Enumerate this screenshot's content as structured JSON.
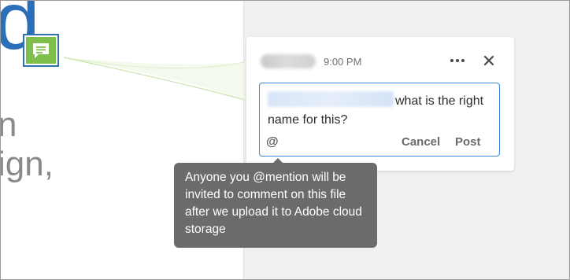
{
  "document": {
    "heading_fragment": "d",
    "line1_fragment": "n",
    "line2_fragment": "ign,"
  },
  "comment": {
    "time": "9:00 PM",
    "draft_text": "what is the right name for this?",
    "actions": {
      "mention_label": "@",
      "cancel_label": "Cancel",
      "post_label": "Post"
    }
  },
  "tooltip": {
    "text": "Anyone you @mention will be invited to comment on this file after we upload it to Adobe cloud storage"
  },
  "colors": {
    "accent_blue": "#3b86d8",
    "marker_green": "#7dbf4a",
    "tooltip_bg": "#6b6b6b",
    "panel_bg": "#f0f0f0"
  },
  "icons": {
    "marker": "comment-bubble-icon",
    "more": "more-options-icon",
    "close": "close-icon"
  }
}
